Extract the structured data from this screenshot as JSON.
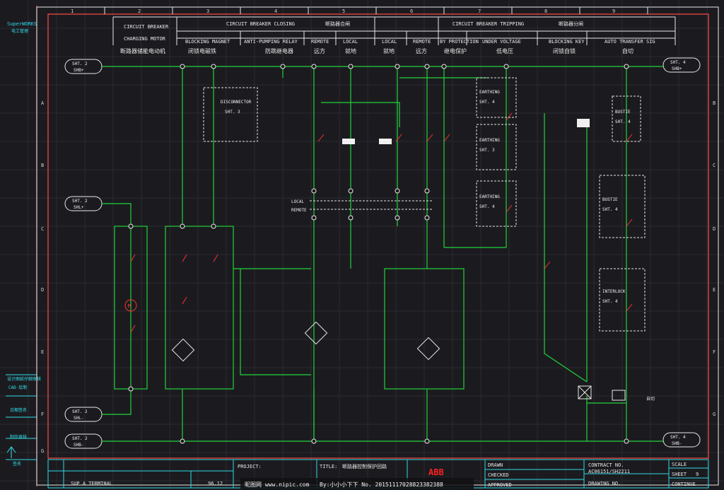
{
  "logo": {
    "line1": "SuperWORKS",
    "line2": "电工管理"
  },
  "grid_cols": [
    "1",
    "2",
    "3",
    "4",
    "5",
    "6",
    "7",
    "8",
    "9"
  ],
  "grid_rows": [
    "A",
    "B",
    "C",
    "D",
    "E",
    "F",
    "G"
  ],
  "headers": {
    "motor_group": {
      "en1": "CIRCUIT BREAKER",
      "en2": "CHARGING MOTOR",
      "cn": "断路器储能电动机"
    },
    "closing_group": {
      "en": "CIRCUIT BREAKER CLOSING",
      "cn": "断路器合闸"
    },
    "tripping_group": {
      "en": "CIRCUIT BREAKER TRIPPING",
      "cn": "断路器分闸"
    },
    "closing_cols": [
      {
        "en": "BLOCKING MAGNET",
        "cn": "闭锁电磁铁"
      },
      {
        "en": "ANTI-PUMPING RELAY",
        "cn": "防跳继电器"
      },
      {
        "en": "REMOTE",
        "cn": "远方"
      },
      {
        "en": "LOCAL",
        "cn": "就地"
      }
    ],
    "tripping_cols": [
      {
        "en": "LOCAL",
        "cn": "就地"
      },
      {
        "en": "REMOTE",
        "cn": "远方"
      },
      {
        "en": "BY PROTECTION",
        "cn": "继电保护"
      },
      {
        "en": "UNDER VOLTAGE",
        "cn": "低电压"
      },
      {
        "en": "BLOCKING KEY",
        "cn": "闭锁自锁"
      },
      {
        "en": "AUTO TRANSFER SIG",
        "cn": "自切"
      }
    ]
  },
  "sheet_refs": {
    "top_left": {
      "l1": "SHT. 2",
      "l2": "SHB+"
    },
    "top_right": {
      "l1": "SHT. 4",
      "l2": "SHB+"
    },
    "mid_left": {
      "l1": "SHT. 2",
      "l2": "SHL+"
    },
    "bot_left_a": {
      "l1": "SHT. 2",
      "l2": "SHL-"
    },
    "bot_left_b": {
      "l1": "SHT. 2",
      "l2": "SHB-"
    },
    "bot_right": {
      "l1": "SHT. 4",
      "l2": "SHB-"
    }
  },
  "boxes": {
    "disconnector": {
      "l1": "DISCONNECTOR",
      "l2": "SHT. 3"
    },
    "earthing1": {
      "l1": "EARTHING",
      "l2": "SHT. 4"
    },
    "earthing2": {
      "l1": "EARTHING",
      "l2": "SHT. 3"
    },
    "earthing3": {
      "l1": "EARTHING",
      "l2": "SHT. 4"
    },
    "bus_right1": {
      "l1": "BUSTIE",
      "l2": "SHT. 4"
    },
    "bus_right2": {
      "l1": "BUSTIE",
      "l2": "SHT. 4"
    },
    "bus_right3": {
      "l1": "INTERLOCK",
      "l2": "SHT. 4"
    }
  },
  "bus_labels": {
    "local": "LOCAL",
    "remote": "REMOTE"
  },
  "tag_right": "自切",
  "side_labels": [
    "设计图纸仔细审核",
    "CAD 绘制",
    "日期签名",
    "制作审核",
    "签名"
  ],
  "title_block": {
    "left": "SUP A TERMINAL",
    "left_num": "96.12",
    "project_label": "PROJECT:",
    "title_label": "TITLE:",
    "title_cn": "断路器控制保护回路",
    "brand": "ABB",
    "drawn": "DRAWN",
    "checked": "CHECKED",
    "approved": "APPROVED",
    "contract_label": "CONTRACT NO.",
    "contract_no": "AC06151/SH2211",
    "drawing_label": "DRAWING NO.",
    "scale": "SCALE",
    "sheet": "SHEET",
    "sheet_no": "9",
    "cont": "CONTINUE"
  },
  "watermark": {
    "site": "昵图网 www.nipic.com",
    "id": "By:小小小下下   No. 20151117028823382388"
  }
}
